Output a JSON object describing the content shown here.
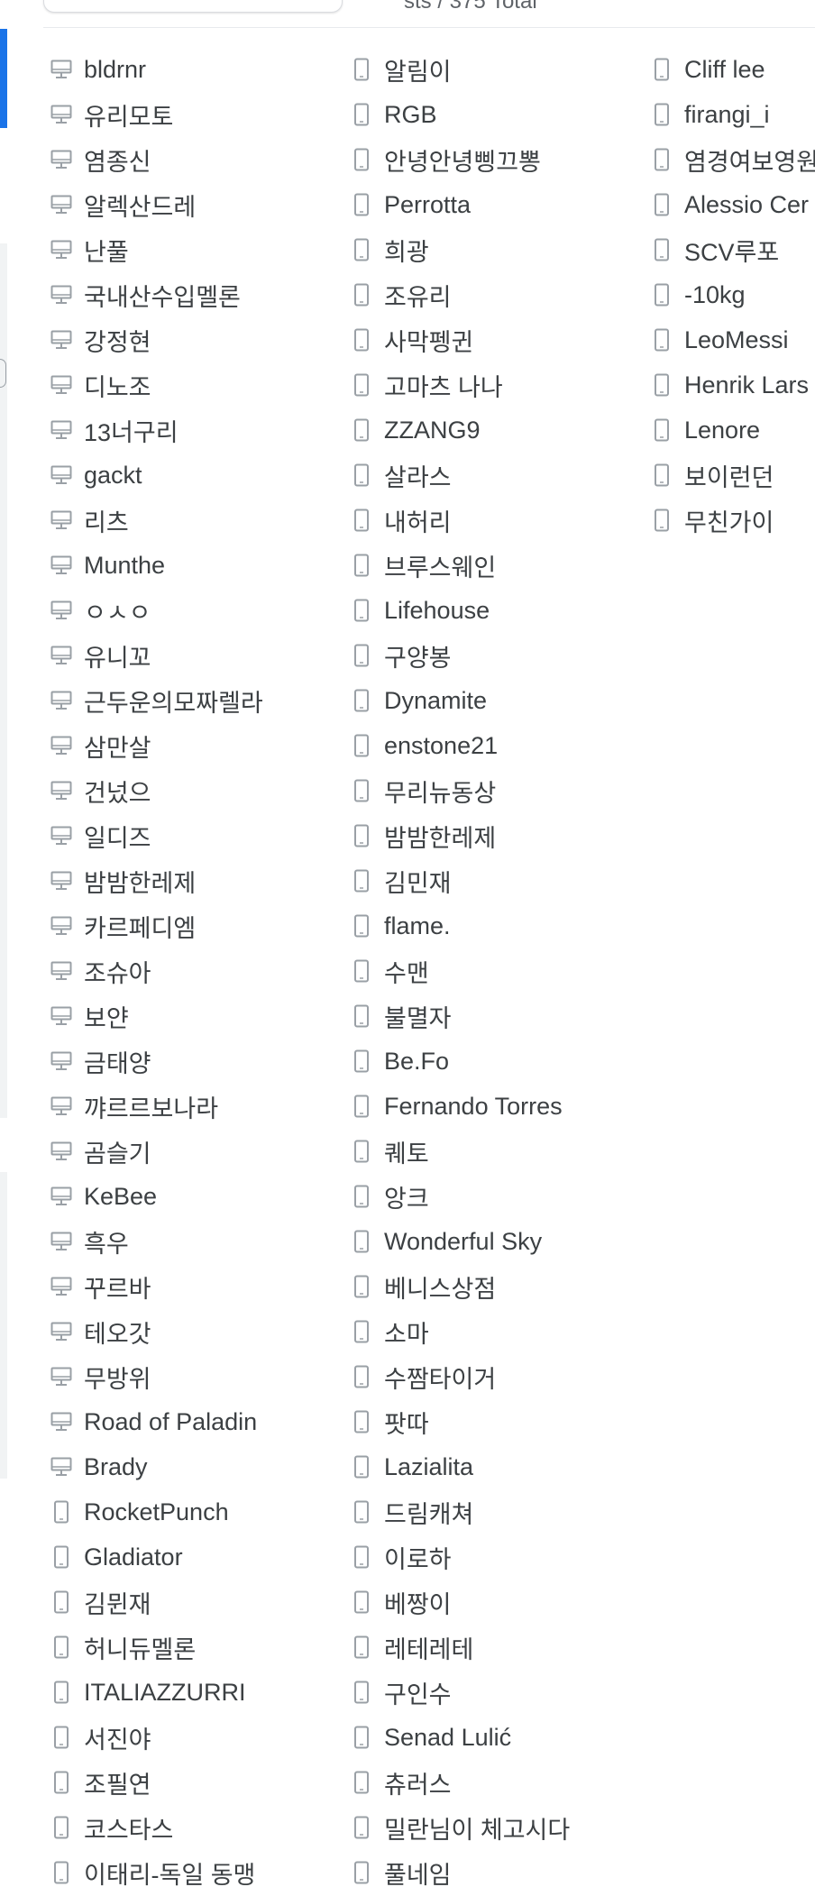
{
  "header": {
    "summary": "sts / 375 Total"
  },
  "columns": [
    {
      "items": [
        {
          "label": "bldrnr",
          "icon": "desktop-icon"
        },
        {
          "label": "유리모토",
          "icon": "desktop-icon"
        },
        {
          "label": "염종신",
          "icon": "desktop-icon"
        },
        {
          "label": "알렉산드레",
          "icon": "desktop-icon"
        },
        {
          "label": "난풀",
          "icon": "desktop-icon"
        },
        {
          "label": "국내산수입멜론",
          "icon": "desktop-icon"
        },
        {
          "label": "강정현",
          "icon": "desktop-icon"
        },
        {
          "label": "디노조",
          "icon": "desktop-icon"
        },
        {
          "label": "13너구리",
          "icon": "desktop-icon"
        },
        {
          "label": "gackt",
          "icon": "desktop-icon"
        },
        {
          "label": "리츠",
          "icon": "desktop-icon"
        },
        {
          "label": "Munthe",
          "icon": "desktop-icon"
        },
        {
          "label": "ㅇㅅㅇ",
          "icon": "desktop-icon"
        },
        {
          "label": "유니꼬",
          "icon": "desktop-icon"
        },
        {
          "label": "근두운의모짜렐라",
          "icon": "desktop-icon"
        },
        {
          "label": "삼만살",
          "icon": "desktop-icon"
        },
        {
          "label": "건넜으",
          "icon": "desktop-icon"
        },
        {
          "label": "일디즈",
          "icon": "desktop-icon"
        },
        {
          "label": "밤밤한레제",
          "icon": "desktop-icon"
        },
        {
          "label": "카르페디엠",
          "icon": "desktop-icon"
        },
        {
          "label": "조슈아",
          "icon": "desktop-icon"
        },
        {
          "label": "보얀",
          "icon": "desktop-icon"
        },
        {
          "label": "금태양",
          "icon": "desktop-icon"
        },
        {
          "label": "꺄르르보나라",
          "icon": "desktop-icon"
        },
        {
          "label": "곰슬기",
          "icon": "desktop-icon"
        },
        {
          "label": "KeBee",
          "icon": "desktop-icon"
        },
        {
          "label": "흑우",
          "icon": "desktop-icon"
        },
        {
          "label": "꾸르바",
          "icon": "desktop-icon"
        },
        {
          "label": "테오갓",
          "icon": "desktop-icon"
        },
        {
          "label": "무방위",
          "icon": "desktop-icon"
        },
        {
          "label": "Road of Paladin",
          "icon": "desktop-icon"
        },
        {
          "label": "Brady",
          "icon": "desktop-icon"
        },
        {
          "label": "RocketPunch",
          "icon": "mobile-icon"
        },
        {
          "label": "Gladiator",
          "icon": "mobile-icon"
        },
        {
          "label": "김뮌재",
          "icon": "mobile-icon"
        },
        {
          "label": "허니듀멜론",
          "icon": "mobile-icon"
        },
        {
          "label": "ITALIAZZURRI",
          "icon": "mobile-icon"
        },
        {
          "label": "서진야",
          "icon": "mobile-icon"
        },
        {
          "label": "조필연",
          "icon": "mobile-icon"
        },
        {
          "label": "코스타스",
          "icon": "mobile-icon"
        },
        {
          "label": "이태리-독일 동맹",
          "icon": "mobile-icon"
        }
      ]
    },
    {
      "items": [
        {
          "label": "알림이",
          "icon": "mobile-icon"
        },
        {
          "label": "RGB",
          "icon": "mobile-icon"
        },
        {
          "label": "안녕안녕삥끄뽕",
          "icon": "mobile-icon"
        },
        {
          "label": "Perrotta",
          "icon": "mobile-icon"
        },
        {
          "label": "희광",
          "icon": "mobile-icon"
        },
        {
          "label": "조유리",
          "icon": "mobile-icon"
        },
        {
          "label": "사막펭귄",
          "icon": "mobile-icon"
        },
        {
          "label": "고마츠 나나",
          "icon": "mobile-icon"
        },
        {
          "label": "ZZANG9",
          "icon": "mobile-icon"
        },
        {
          "label": "살라스",
          "icon": "mobile-icon"
        },
        {
          "label": "내허리",
          "icon": "mobile-icon"
        },
        {
          "label": "브루스웨인",
          "icon": "mobile-icon"
        },
        {
          "label": "Lifehouse",
          "icon": "mobile-icon"
        },
        {
          "label": "구양봉",
          "icon": "mobile-icon"
        },
        {
          "label": "Dynamite",
          "icon": "mobile-icon"
        },
        {
          "label": "enstone21",
          "icon": "mobile-icon"
        },
        {
          "label": "무리뉴동상",
          "icon": "mobile-icon"
        },
        {
          "label": "밤밤한레제",
          "icon": "mobile-icon"
        },
        {
          "label": "김민재",
          "icon": "mobile-icon"
        },
        {
          "label": "flame.",
          "icon": "mobile-icon"
        },
        {
          "label": "수맨",
          "icon": "mobile-icon"
        },
        {
          "label": "불멸자",
          "icon": "mobile-icon"
        },
        {
          "label": "Be.Fo",
          "icon": "mobile-icon"
        },
        {
          "label": "Fernando Torres",
          "icon": "mobile-icon"
        },
        {
          "label": "퀘토",
          "icon": "mobile-icon"
        },
        {
          "label": "앙크",
          "icon": "mobile-icon"
        },
        {
          "label": "Wonderful Sky",
          "icon": "mobile-icon"
        },
        {
          "label": "베니스상점",
          "icon": "mobile-icon"
        },
        {
          "label": "소마",
          "icon": "mobile-icon"
        },
        {
          "label": "수짬타이거",
          "icon": "mobile-icon"
        },
        {
          "label": "팟따",
          "icon": "mobile-icon"
        },
        {
          "label": "Lazialita",
          "icon": "mobile-icon"
        },
        {
          "label": "드림캐쳐",
          "icon": "mobile-icon"
        },
        {
          "label": "이로하",
          "icon": "mobile-icon"
        },
        {
          "label": "베짱이",
          "icon": "mobile-icon"
        },
        {
          "label": "레테레테",
          "icon": "mobile-icon"
        },
        {
          "label": "구인수",
          "icon": "mobile-icon"
        },
        {
          "label": "Senad Lulić",
          "icon": "mobile-icon"
        },
        {
          "label": "츄러스",
          "icon": "mobile-icon"
        },
        {
          "label": "밀란님이 체고시다",
          "icon": "mobile-icon"
        },
        {
          "label": "풀네임",
          "icon": "mobile-icon"
        }
      ]
    },
    {
      "items": [
        {
          "label": "Cliff lee",
          "icon": "mobile-icon"
        },
        {
          "label": "firangi_i",
          "icon": "mobile-icon"
        },
        {
          "label": "염경여보영원",
          "icon": "mobile-icon"
        },
        {
          "label": "Alessio Cer",
          "icon": "mobile-icon"
        },
        {
          "label": "SCV루포",
          "icon": "mobile-icon"
        },
        {
          "label": "-10kg",
          "icon": "mobile-icon"
        },
        {
          "label": "LeoMessi",
          "icon": "mobile-icon"
        },
        {
          "label": "Henrik Lars",
          "icon": "mobile-icon"
        },
        {
          "label": "Lenore",
          "icon": "mobile-icon"
        },
        {
          "label": "보이런던",
          "icon": "mobile-icon"
        },
        {
          "label": "무친가이",
          "icon": "mobile-icon"
        }
      ]
    }
  ],
  "colors": {
    "text": "#3c4043",
    "icon": "#9aa0a6",
    "accent": "#1a73e8"
  }
}
